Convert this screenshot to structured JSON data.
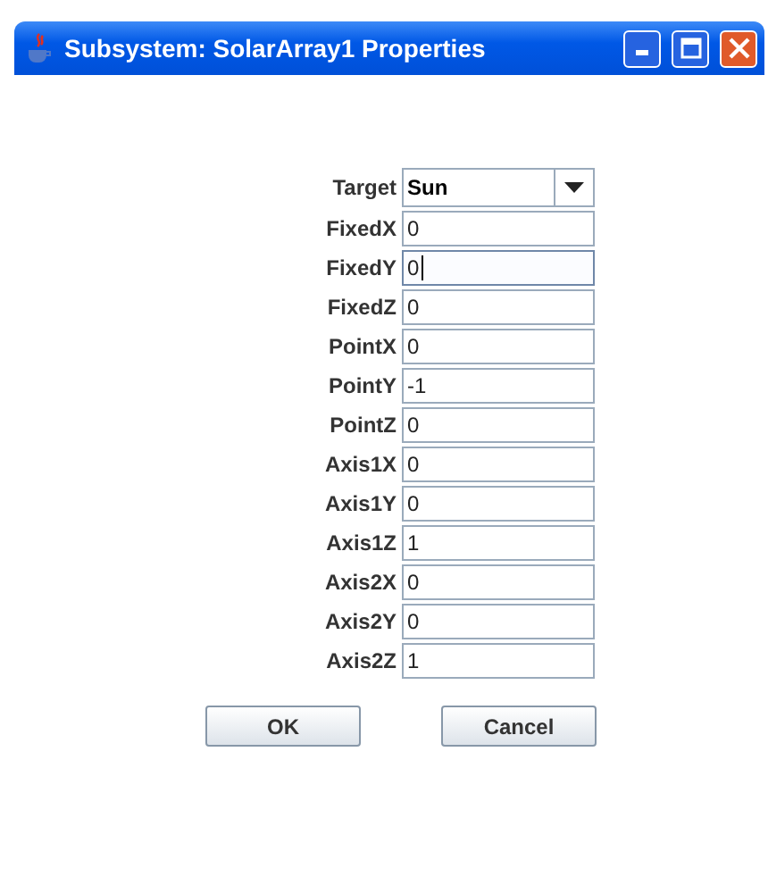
{
  "window": {
    "title": "Subsystem: SolarArray1 Properties"
  },
  "form": {
    "target": {
      "label": "Target",
      "value": "Sun"
    },
    "fields": [
      {
        "label": "FixedX",
        "value": "0",
        "focused": false
      },
      {
        "label": "FixedY",
        "value": "0",
        "focused": true
      },
      {
        "label": "FixedZ",
        "value": "0",
        "focused": false
      },
      {
        "label": "PointX",
        "value": "0",
        "focused": false
      },
      {
        "label": "PointY",
        "value": "-1",
        "focused": false
      },
      {
        "label": "PointZ",
        "value": "0",
        "focused": false
      },
      {
        "label": "Axis1X",
        "value": "0",
        "focused": false
      },
      {
        "label": "Axis1Y",
        "value": "0",
        "focused": false
      },
      {
        "label": "Axis1Z",
        "value": "1",
        "focused": false
      },
      {
        "label": "Axis2X",
        "value": "0",
        "focused": false
      },
      {
        "label": "Axis2Y",
        "value": "0",
        "focused": false
      },
      {
        "label": "Axis2Z",
        "value": "1",
        "focused": false
      }
    ]
  },
  "buttons": [
    "OK",
    "Cancel"
  ]
}
